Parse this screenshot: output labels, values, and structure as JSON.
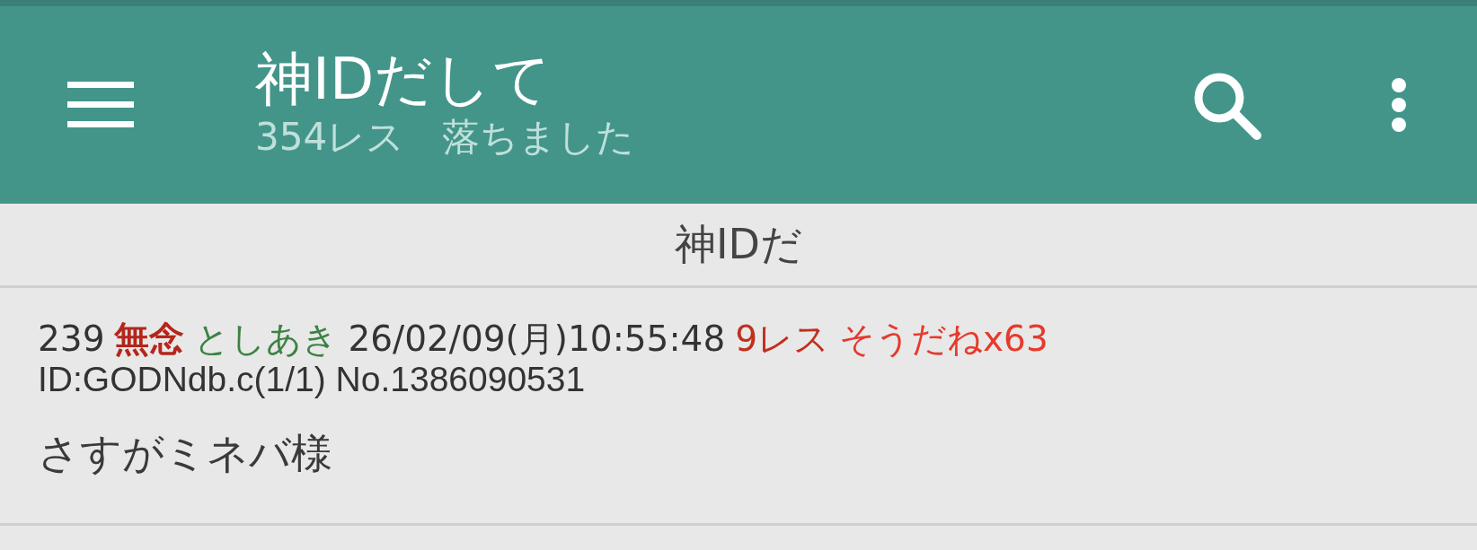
{
  "app_bar": {
    "title": "神IDだして",
    "subtitle": "354レス　落ちました"
  },
  "thread_title": "神IDだ",
  "posts": [
    {
      "header": [
        {
          "kind": "number",
          "text": "239",
          "color": "#333333"
        },
        {
          "kind": "name",
          "text": "無念",
          "color": "#b5261b"
        },
        {
          "kind": "handle",
          "text": "としあき",
          "color": "#3c8244"
        },
        {
          "kind": "date",
          "text": "26/02/09(月)10:55:48",
          "color": "#333333"
        },
        {
          "kind": "replies",
          "text": "9レス",
          "color": "#c0301f"
        },
        {
          "kind": "likes",
          "text": "そうだねx63",
          "color": "#e53a2c"
        }
      ],
      "id_line": "ID:GODNdb.c(1/1) No.1386090531",
      "body": "さすがミネバ様"
    }
  ]
}
